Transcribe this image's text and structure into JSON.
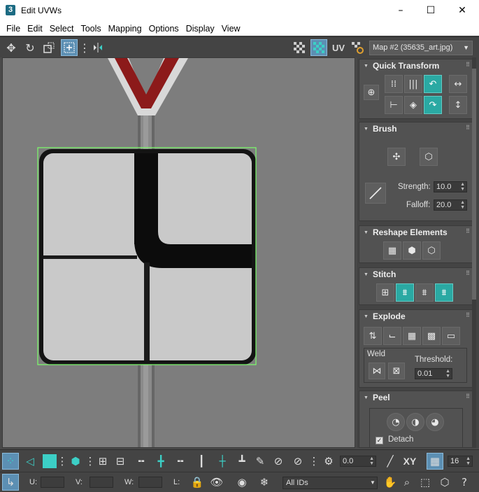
{
  "window": {
    "title": "Edit UVWs",
    "app_icon": "3",
    "minimize": "–",
    "maximize": "☐",
    "close": "✕"
  },
  "menu": [
    "File",
    "Edit",
    "Select",
    "Tools",
    "Mapping",
    "Options",
    "Display",
    "View"
  ],
  "toolbar": {
    "uv_label": "UV",
    "map_dropdown": "Map #2 (35635_art.jpg)"
  },
  "quick_transform": {
    "title": "Quick Transform"
  },
  "brush": {
    "title": "Brush",
    "strength_label": "Strength:",
    "strength_value": "10.0",
    "falloff_label": "Falloff:",
    "falloff_value": "20.0"
  },
  "reshape": {
    "title": "Reshape Elements"
  },
  "stitch": {
    "title": "Stitch"
  },
  "explode": {
    "title": "Explode",
    "weld_label": "Weld",
    "threshold_label": "Threshold:",
    "threshold_value": "0.01"
  },
  "peel": {
    "title": "Peel",
    "detach_label": "Detach",
    "detach_checked": true
  },
  "bottom": {
    "rotate_value": "0.0",
    "xy_label": "XY",
    "grid_value": "16",
    "u_label": "U:",
    "v_label": "V:",
    "w_label": "W:",
    "l_label": "L:",
    "ids_dropdown": "All IDs"
  },
  "colors": {
    "accent_teal": "#2aa9a3",
    "active_blue": "#5c8fb3",
    "uv_selection_green": "#7cff6a",
    "sign_red": "#8c1a1a"
  }
}
